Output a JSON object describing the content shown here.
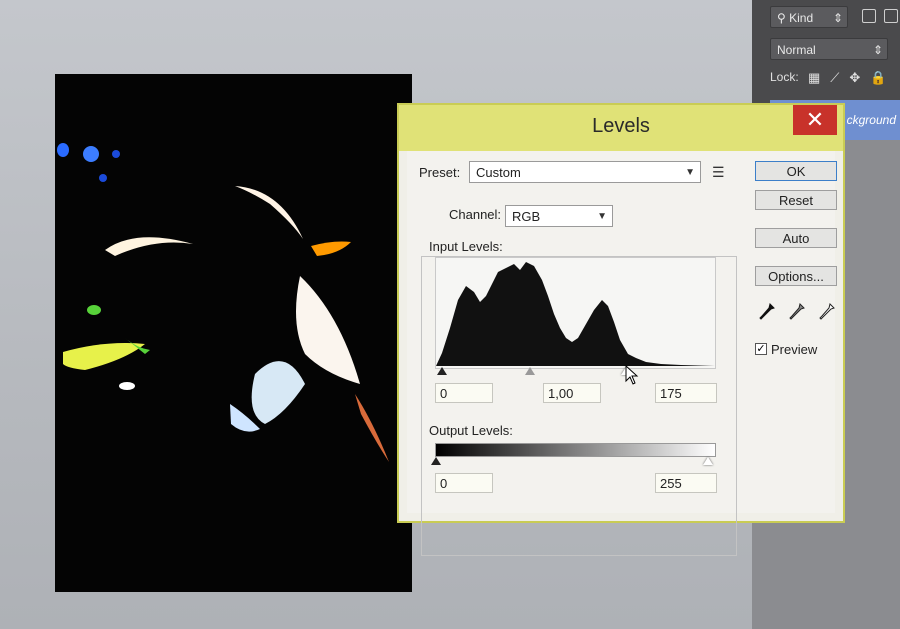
{
  "app_panel": {
    "kind_label": "Kind",
    "blend_mode": "Normal",
    "lock_label": "Lock:",
    "layer_name": "ckground"
  },
  "dialog": {
    "title": "Levels",
    "close_glyph": "✕",
    "preset_label": "Preset:",
    "preset_value": "Custom",
    "channel_label": "Channel:",
    "channel_value": "RGB",
    "input_levels_label": "Input Levels:",
    "input_black": "0",
    "input_gamma": "1,00",
    "input_white": "175",
    "output_levels_label": "Output Levels:",
    "output_black": "0",
    "output_white": "255",
    "buttons": {
      "ok": "OK",
      "reset": "Reset",
      "auto": "Auto",
      "options": "Options..."
    },
    "preview_label": "Preview",
    "preview_checked": true
  },
  "icons": {
    "close": "close-icon",
    "preset_menu": "list-menu-icon",
    "eyedropper_black": "eyedropper-black-icon",
    "eyedropper_gray": "eyedropper-gray-icon",
    "eyedropper_white": "eyedropper-white-icon"
  },
  "colors": {
    "titlebar": "#e0e277",
    "close_button": "#c8322a",
    "selected_layer": "#6f8fd0"
  }
}
